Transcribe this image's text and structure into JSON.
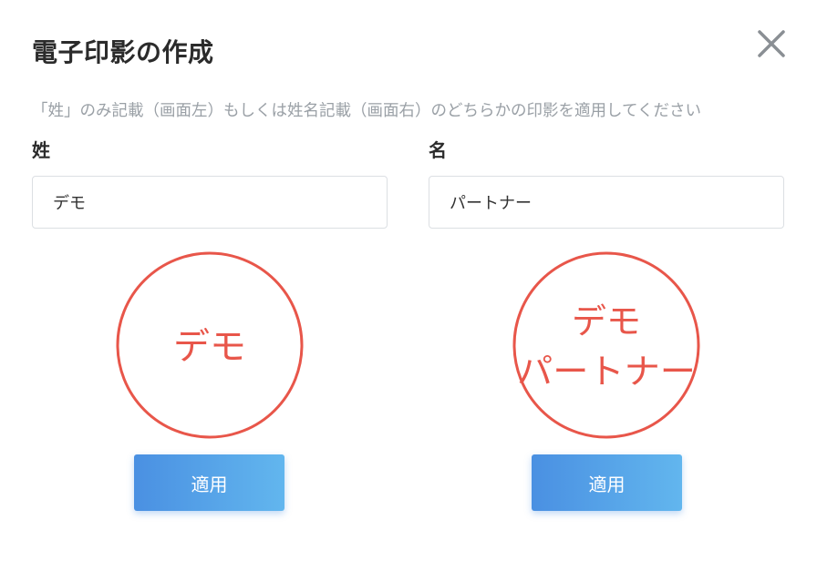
{
  "dialog": {
    "title": "電子印影の作成",
    "description": "「姓」のみ記載（画面左）もしくは姓名記載（画面右）のどちらかの印影を適用してください"
  },
  "fields": {
    "last_name": {
      "label": "姓",
      "value": "デモ"
    },
    "first_name": {
      "label": "名",
      "value": "パートナー"
    }
  },
  "seals": {
    "left": {
      "line1": "デモ"
    },
    "right": {
      "line1": "デモ",
      "line2": "パートナー"
    }
  },
  "buttons": {
    "apply_left": "適用",
    "apply_right": "適用"
  },
  "colors": {
    "seal_red": "#e8564a",
    "button_start": "#4a90e2",
    "button_end": "#62b6ee"
  }
}
